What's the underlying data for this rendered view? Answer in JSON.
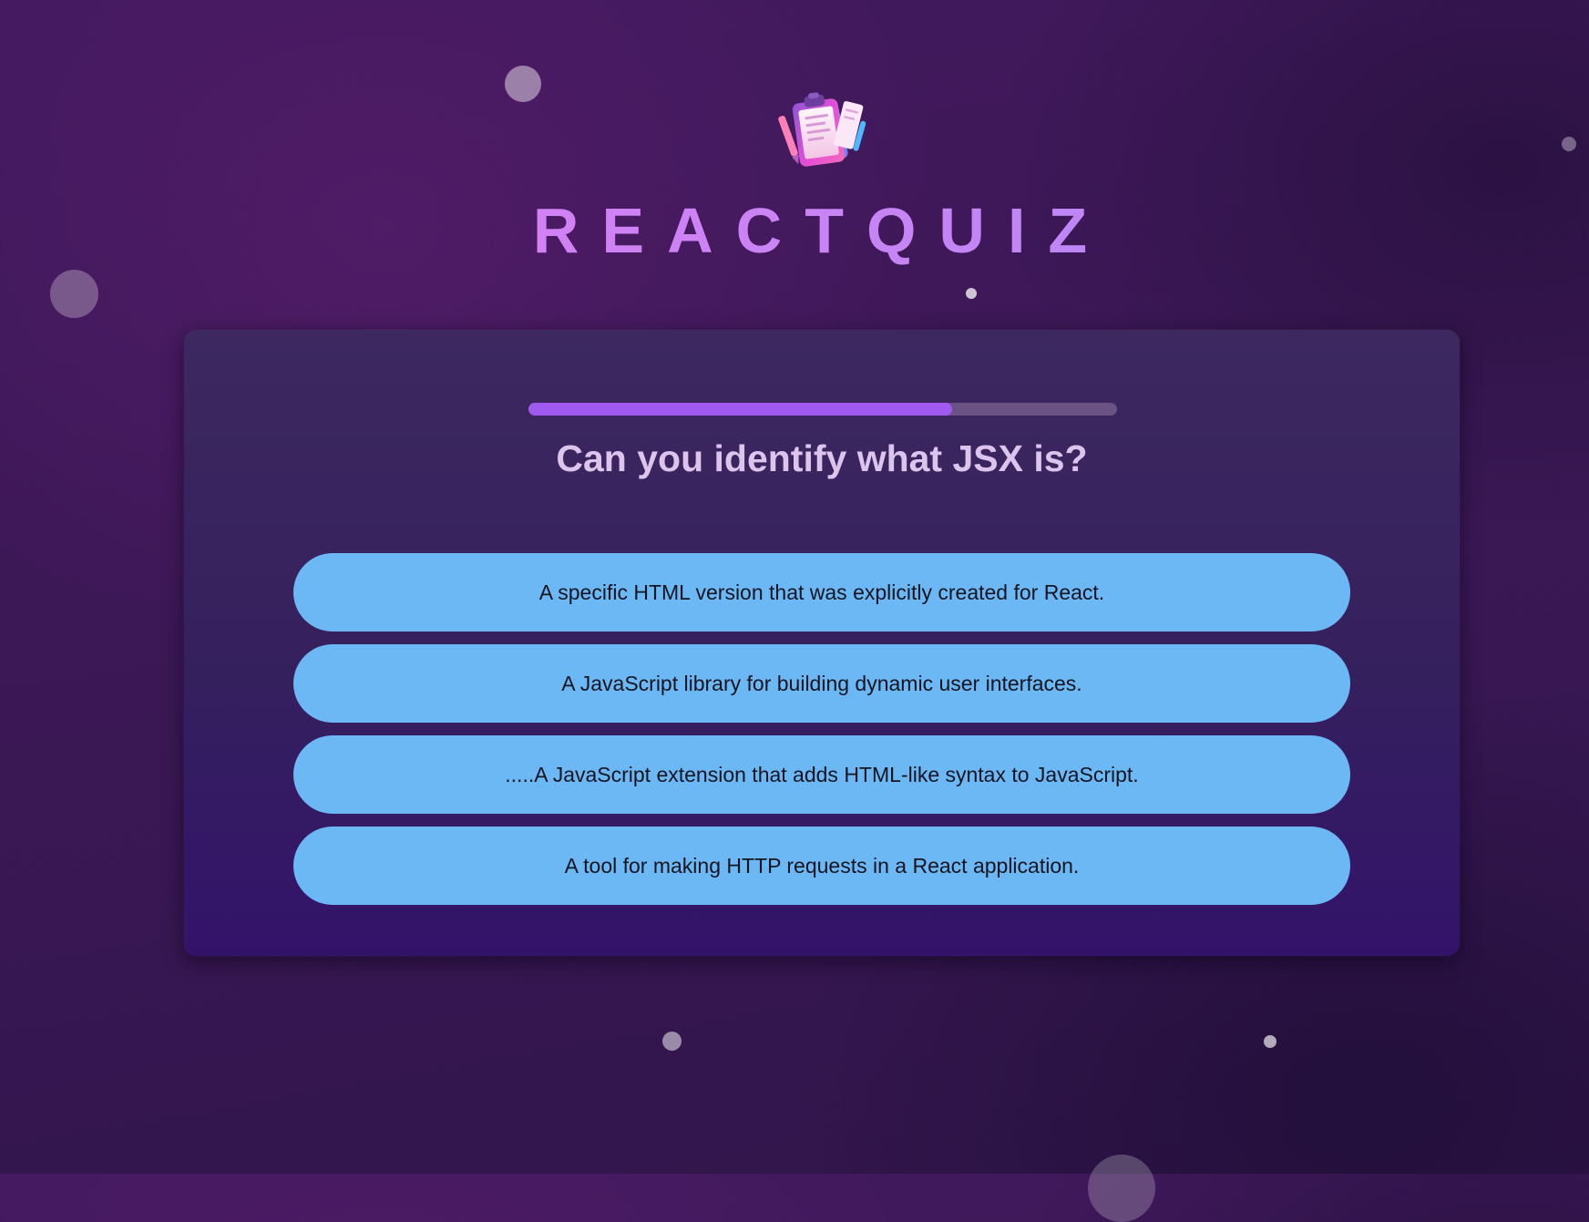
{
  "app": {
    "title": "REACTQUIZ",
    "logo_icon": "clipboard-quiz-icon"
  },
  "quiz": {
    "progress_fraction": 0.72,
    "question": "Can you identify what JSX is?",
    "options": [
      {
        "label": "A specific HTML version that was explicitly created for React."
      },
      {
        "label": "A JavaScript library for building dynamic user interfaces."
      },
      {
        "label": ".....A JavaScript extension that adds HTML-like syntax to JavaScript."
      },
      {
        "label": "A tool for making HTTP requests in a React application."
      }
    ]
  },
  "colors": {
    "background": "#3a1856",
    "card": "#35205e",
    "progress_fill": "#a15af0",
    "progress_track": "#6a5384",
    "option_background": "#6cb8f5",
    "title_gradient_start": "#e17cf6",
    "title_gradient_end": "#a58cf7"
  }
}
